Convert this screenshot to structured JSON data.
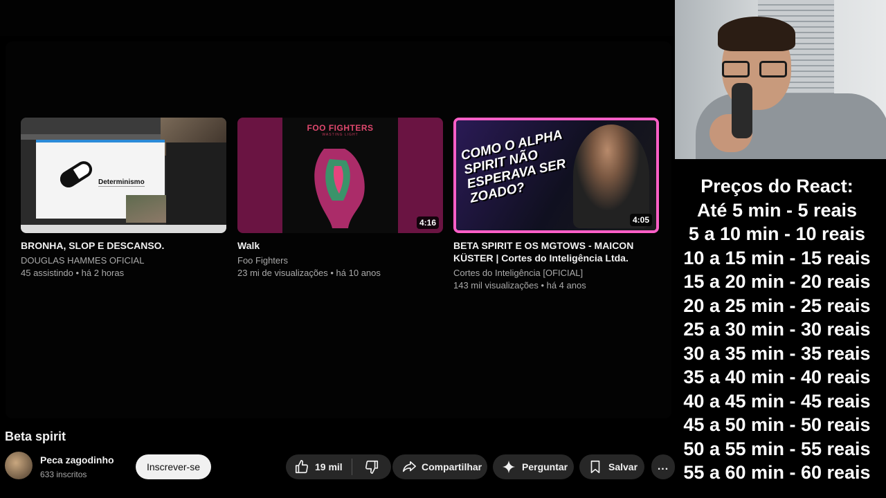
{
  "related_videos": [
    {
      "title": "BRONHA, SLOP E DESCANSO.",
      "channel": "DOUGLAS HAMMES OFICIAL",
      "meta": "45 assistindo • há 2 horas",
      "duration": "",
      "thumb_text": "Determinismo"
    },
    {
      "title": "Walk",
      "channel": "Foo Fighters",
      "meta": "23 mi de visualizações • há 10 anos",
      "duration": "4:16",
      "thumb_text": "FOO FIGHTERS",
      "thumb_subtext": "WASTING LIGHT"
    },
    {
      "title": "BETA SPIRIT E OS MGTOWS - MAICON KÜSTER | Cortes do Inteligência Ltda.",
      "channel": "Cortes do Inteligência [OFICIAL]",
      "meta": "143 mil visualizações • há 4 anos",
      "duration": "4:05",
      "thumb_text": "COMO O ALPHA SPIRIT NÃO ESPERAVA SER ZOADO?"
    }
  ],
  "video": {
    "title": "Beta spirit",
    "channel_name": "Peca zagodinho",
    "subscribers": "633 inscritos",
    "subscribe_label": "Inscrever-se",
    "likes": "19 mil",
    "share_label": "Compartilhar",
    "ask_label": "Perguntar",
    "save_label": "Salvar",
    "more_label": "..."
  },
  "overlay": {
    "prices_title": "Preços do React:",
    "price_lines": [
      "Até 5 min - 5 reais",
      "5 a 10 min - 10 reais",
      "10 a 15 min - 15 reais",
      "15 a 20 min - 20 reais",
      "20 a 25 min - 25 reais",
      "25 a 30 min - 30 reais",
      "30 a 35 min - 35 reais",
      "35 a 40 min - 40 reais",
      "40 a 45 min - 45 reais",
      "45 a 50 min - 50 reais",
      "50 a 55 min - 55 reais",
      "55 a 60 min - 60 reais"
    ]
  },
  "icons": {
    "like": "thumbs-up-icon",
    "dislike": "thumbs-down-icon",
    "share": "share-arrow-icon",
    "ask": "sparkle-icon",
    "save": "bookmark-icon",
    "more": "more-horizontal-icon"
  }
}
